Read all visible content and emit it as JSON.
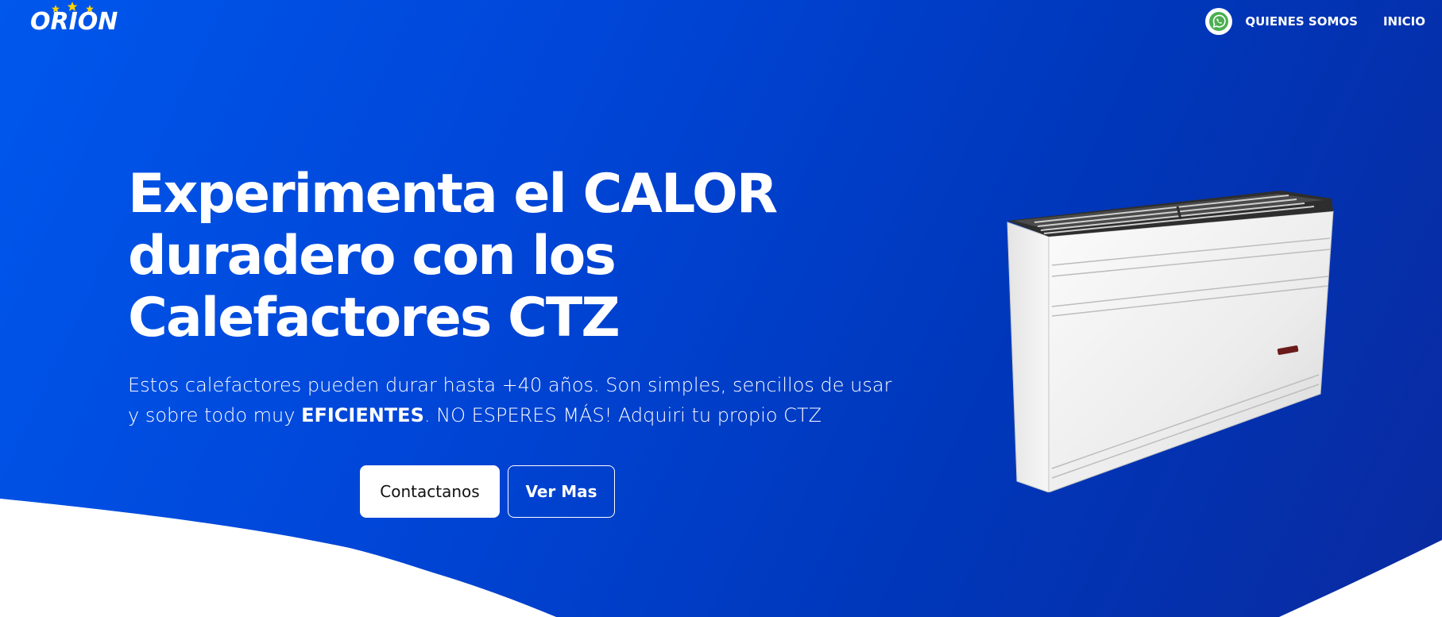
{
  "brand": {
    "name": "ORION"
  },
  "nav": {
    "whatsapp_icon": "whatsapp-icon",
    "links": [
      "QUIENES SOMOS",
      "INICIO"
    ]
  },
  "hero": {
    "title_lines": [
      "Experimenta el CALOR",
      "duradero con los",
      "Calefactores CTZ"
    ],
    "description": {
      "line1": "Estos calefactores pueden durar hasta +40 años. Son simples, sencillos de usar",
      "line2_before": "y sobre todo muy ",
      "line2_bold": "EFICIENTES",
      "line2_after": ". NO ESPERES MÁS! Adquiri tu propio CTZ"
    },
    "buttons": {
      "contact": "Contactanos",
      "more": "Ver Mas"
    }
  },
  "colors": {
    "gradient_start": "#0057ec",
    "gradient_end": "#0a2aa0",
    "star": "#ffd400",
    "whatsapp": "#4caf50"
  }
}
